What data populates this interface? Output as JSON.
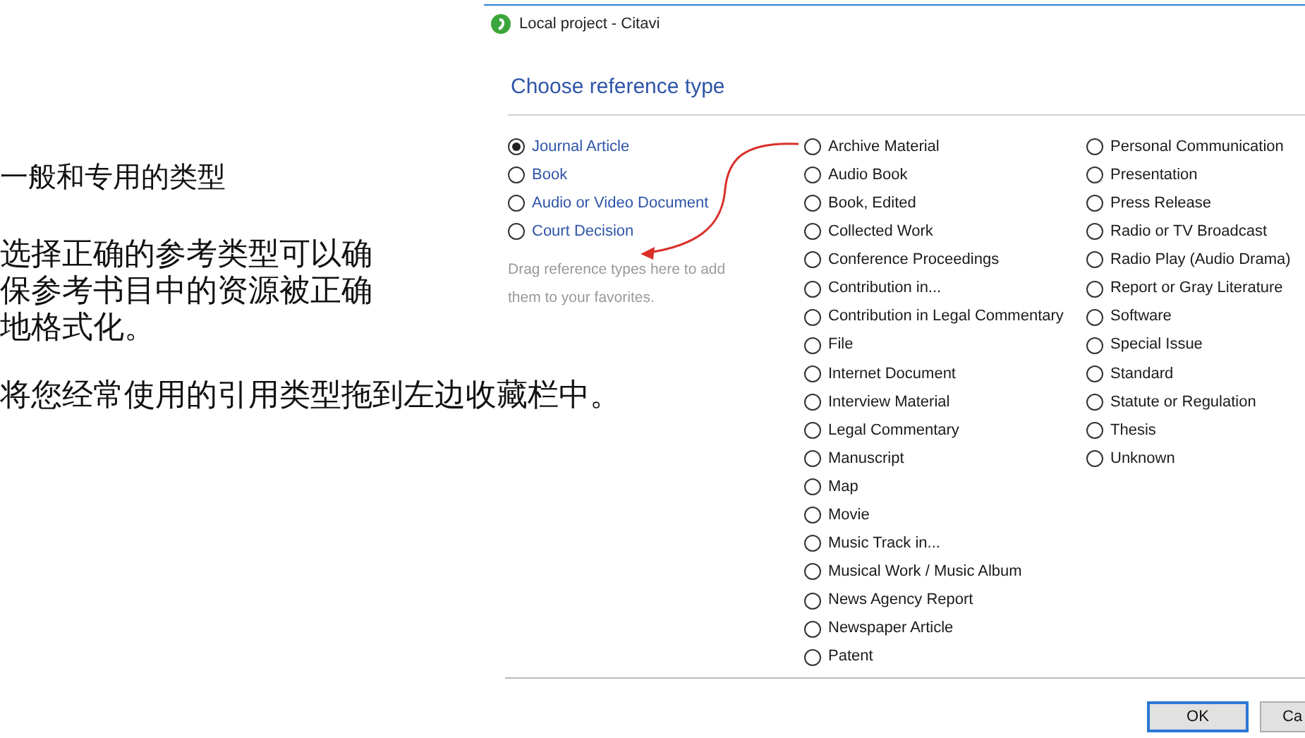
{
  "notes": {
    "heading": "一般和专用的类型",
    "paragraphs": [
      "选择正确的参考类型可以确保参考书目中的资源被正确地格式化。",
      "将您经常使用的引用类型拖到左边收藏栏中。"
    ]
  },
  "window": {
    "title": "Local project - Citavi"
  },
  "dialog": {
    "heading": "Choose reference type",
    "favorites": [
      {
        "label": "Journal Article",
        "selected": true
      },
      {
        "label": "Book",
        "selected": false
      },
      {
        "label": "Audio or Video Document",
        "selected": false
      },
      {
        "label": "Court Decision",
        "selected": false
      }
    ],
    "favorites_hint": "Drag reference types here to add them to your favorites.",
    "columns": [
      {
        "items": [
          {
            "label": "Archive Material",
            "selected": false
          },
          {
            "label": "Audio Book",
            "selected": false
          },
          {
            "label": "Book, Edited",
            "selected": false
          },
          {
            "label": "Collected Work",
            "selected": false
          },
          {
            "label": "Conference Proceedings",
            "selected": false
          },
          {
            "label": "Contribution in...",
            "selected": false
          },
          {
            "label": "Contribution in Legal Commentary",
            "selected": false
          },
          {
            "label": "File",
            "selected": false
          },
          {
            "label": "Internet Document",
            "selected": false
          },
          {
            "label": "Interview Material",
            "selected": false
          },
          {
            "label": "Legal Commentary",
            "selected": false
          },
          {
            "label": "Manuscript",
            "selected": false
          },
          {
            "label": "Map",
            "selected": false
          },
          {
            "label": "Movie",
            "selected": false
          },
          {
            "label": "Music Track in...",
            "selected": false
          },
          {
            "label": "Musical Work / Music Album",
            "selected": false
          },
          {
            "label": "News Agency Report",
            "selected": false
          },
          {
            "label": "Newspaper Article",
            "selected": false
          },
          {
            "label": "Patent",
            "selected": false
          }
        ]
      },
      {
        "items": [
          {
            "label": "Personal Communication",
            "selected": false
          },
          {
            "label": "Presentation",
            "selected": false
          },
          {
            "label": "Press Release",
            "selected": false
          },
          {
            "label": "Radio or TV Broadcast",
            "selected": false
          },
          {
            "label": "Radio Play (Audio Drama)",
            "selected": false
          },
          {
            "label": "Report or Gray Literature",
            "selected": false
          },
          {
            "label": "Software",
            "selected": false
          },
          {
            "label": "Special Issue",
            "selected": false
          },
          {
            "label": "Standard",
            "selected": false
          },
          {
            "label": "Statute or Regulation",
            "selected": false
          },
          {
            "label": "Thesis",
            "selected": false
          },
          {
            "label": "Unknown",
            "selected": false
          }
        ]
      }
    ],
    "buttons": [
      {
        "label": "OK",
        "default": true
      },
      {
        "label": "Ca",
        "default": false
      }
    ]
  }
}
